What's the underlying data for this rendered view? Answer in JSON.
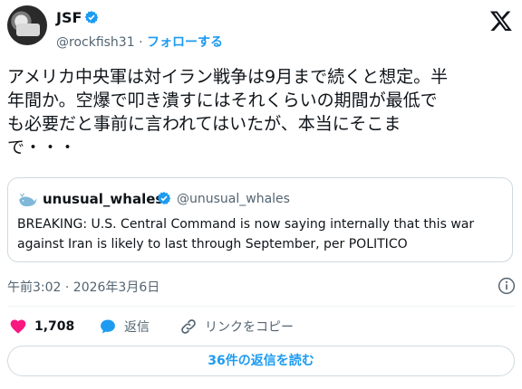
{
  "author": {
    "name": "JSF",
    "handle": "@rockfish31",
    "separator": "·",
    "follow_label": "フォローする"
  },
  "tweet": {
    "text": "アメリカ中央軍は対イラン戦争は9月まで続くと想定。半\n年間か。空爆で叩き潰すにはそれくらいの期間が最低で\nも必要だと事前に言われてはいたが、本当にそこま\nで・・・",
    "timestamp": "午前3:02 · 2026年3月6日"
  },
  "quoted": {
    "name": "unusual_whales",
    "handle": "@unusual_whales",
    "text": "BREAKING: U.S. Central Command is now saying internally that this war against Iran is likely to last through September, per POLITICO"
  },
  "actions": {
    "like_count": "1,708",
    "reply_label": "返信",
    "copy_link_label": "リンクをコピー"
  },
  "read_replies_label": "36件の返信を読む",
  "icons": [
    "verified-icon",
    "x-logo-icon",
    "whale-icon",
    "info-icon",
    "heart-icon",
    "reply-icon",
    "link-icon"
  ],
  "colors": {
    "accent": "#1d9bf0",
    "like": "#f91880",
    "secondary_text": "#536471",
    "border": "#cfd9de"
  }
}
